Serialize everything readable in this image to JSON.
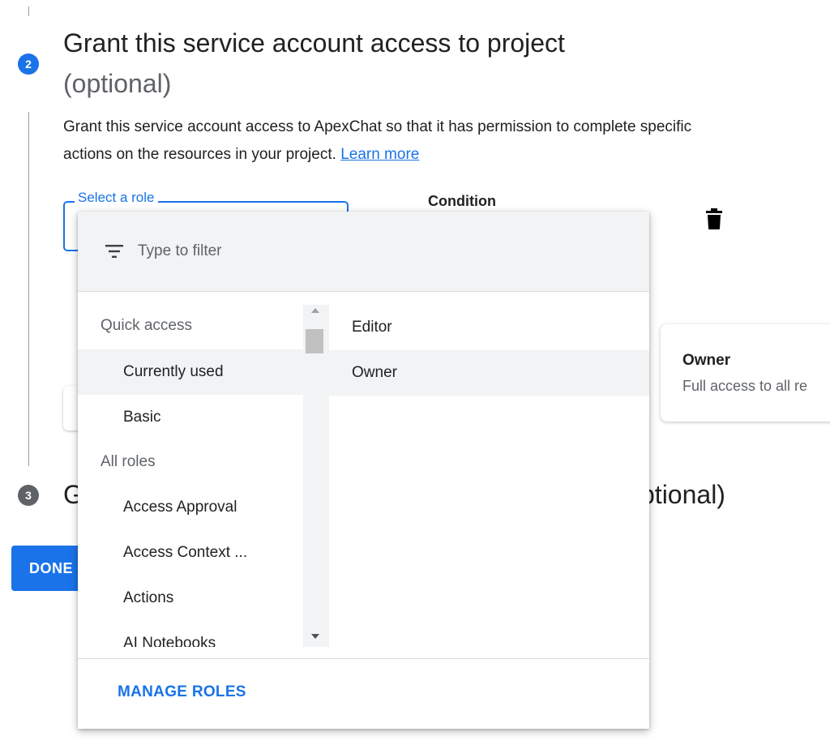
{
  "colors": {
    "accent": "#1a73e8",
    "step_active": "#1a73e8",
    "step_inactive": "#5f6368",
    "muted_text": "#5f6368",
    "hover_bg": "#f1f3f4"
  },
  "step2": {
    "number": "2",
    "title": "Grant this service account access to project",
    "optional": "(optional)",
    "description": "Grant this service account access to ApexChat so that it has permission to complete specific actions on the resources in your project.",
    "learn_more": "Learn more"
  },
  "role_field": {
    "label": "Select a role"
  },
  "condition_label": "Condition",
  "delete_icon": "trash-icon",
  "role_info_card": {
    "title": "Owner",
    "description": "Full access to all re"
  },
  "step3": {
    "number": "3",
    "title_start": "G",
    "title_end": "ptional)"
  },
  "done_button": "DONE",
  "dropdown": {
    "filter_icon": "filter-list-icon",
    "filter_placeholder": "Type to filter",
    "quick_access_header": "Quick access",
    "quick_access_items": [
      "Currently used",
      "Basic"
    ],
    "all_roles_header": "All roles",
    "all_roles_items": [
      "Access Approval",
      "Access Context ...",
      "Actions",
      "AI Notebooks"
    ],
    "selected_category": "Currently used",
    "roles": [
      "Editor",
      "Owner"
    ],
    "hovered_role": "Owner",
    "manage_roles": "MANAGE ROLES"
  }
}
